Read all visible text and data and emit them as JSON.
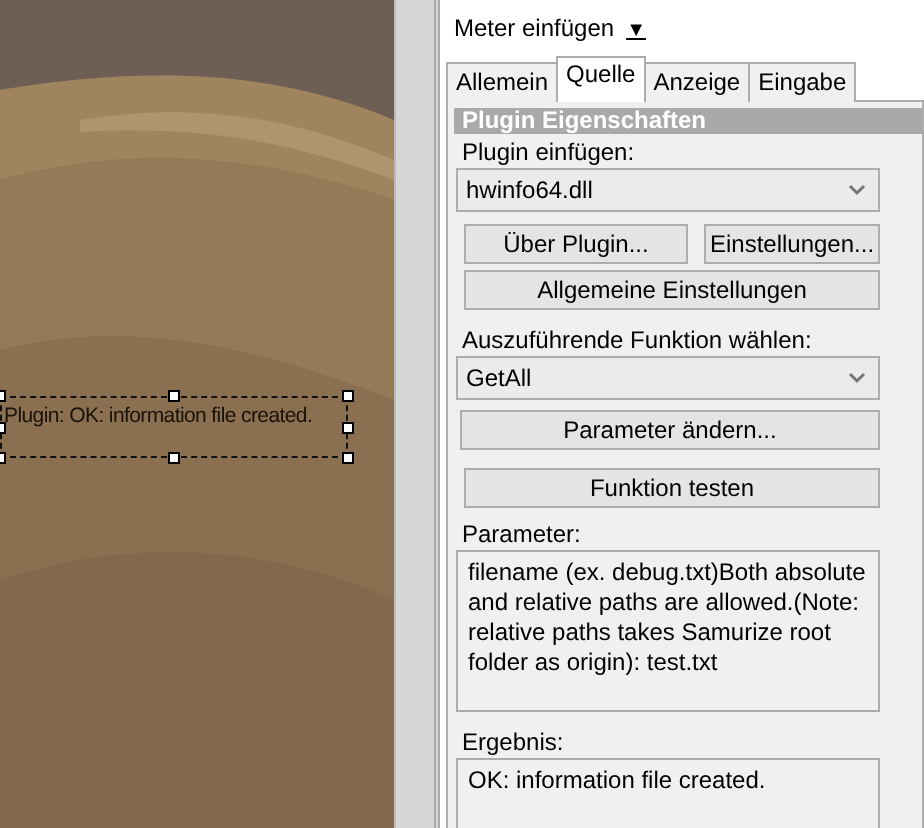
{
  "canvas": {
    "selected_label": {
      "text": "Plugin: OK: information file created.",
      "selected": true
    }
  },
  "toolbar": {
    "menu_label": "Meter einfügen",
    "menu_arrow": "▼"
  },
  "tabs": [
    {
      "label": "Allemein",
      "selected": false
    },
    {
      "label": "Quelle",
      "selected": true
    },
    {
      "label": "Anzeige",
      "selected": false
    },
    {
      "label": "Eingabe",
      "selected": false
    }
  ],
  "group_title": "Plugin Eigenschaften",
  "plugin": {
    "label": "Plugin einfügen:",
    "value": "hwinfo64.dll"
  },
  "plugin_buttons": [
    "Über Plugin...",
    "Einstellungen..."
  ],
  "general_button": "Allgemeine Einstellungen",
  "function": {
    "label": "Auszuführende Funktion wählen:",
    "value": "GetAll"
  },
  "action_buttons": [
    "Parameter ändern...",
    "Funktion testen"
  ],
  "parameter": {
    "label": "Parameter:",
    "text": "filename (ex. debug.txt)Both absolute and relative paths are allowed.(Note: relative paths takes Samurize root folder as origin): test.txt"
  },
  "result": {
    "label": "Ergebnis:",
    "text": "OK: information file created."
  }
}
